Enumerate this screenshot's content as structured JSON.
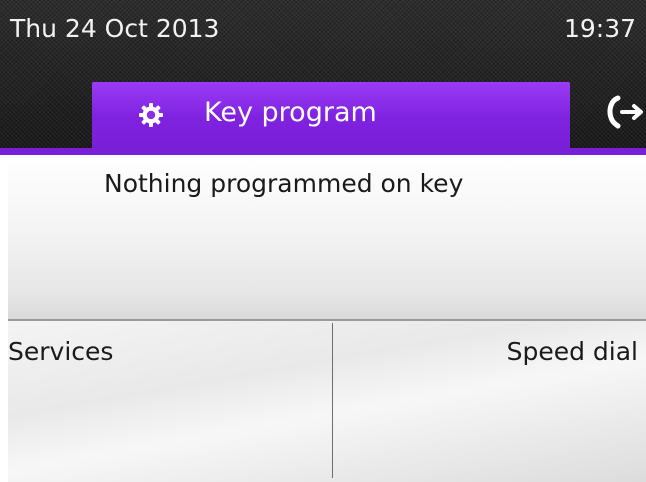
{
  "status_bar": {
    "date": "Thu 24 Oct 2013",
    "time": "19:37"
  },
  "tabs": {
    "active": {
      "label": "Key program",
      "icon": "gear-icon"
    },
    "next_icon": "call-transfer-icon"
  },
  "content": {
    "message": "Nothing programmed on key"
  },
  "softkeys": {
    "left_label": "Services",
    "right_label": "Speed dial"
  },
  "colors": {
    "accent": "#7a1fd8",
    "header_bg": "#222222"
  }
}
